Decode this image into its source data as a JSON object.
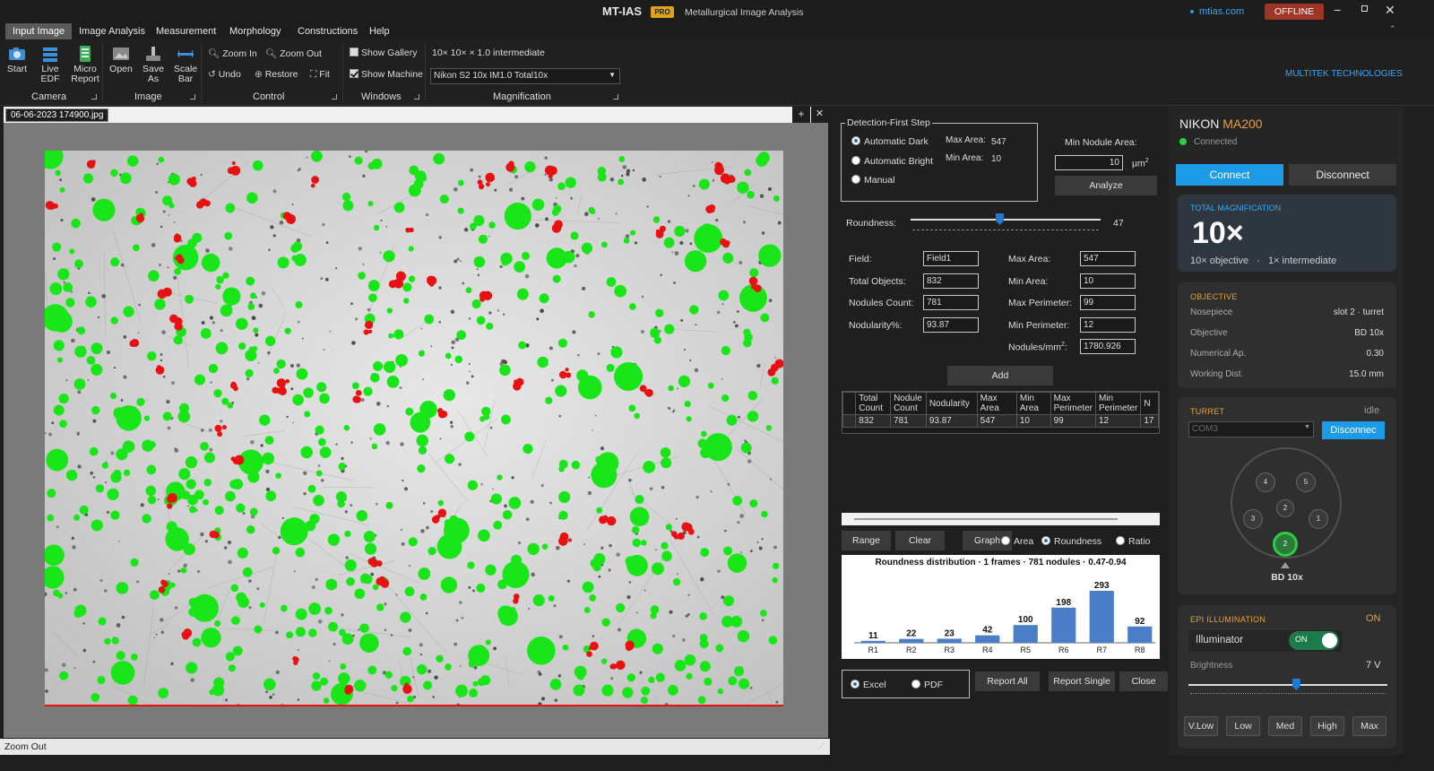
{
  "titlebar": {
    "app": "MT-IAS",
    "badge": "PRO",
    "subtitle": "Metallurgical Image Analysis",
    "site": "mtias.com",
    "offline": "OFFLINE"
  },
  "menu": [
    "Input Image",
    "Image Analysis",
    "Measurement",
    "Morphology",
    "Constructions",
    "Help"
  ],
  "ribbon": {
    "camera": {
      "start": "Start",
      "live_edf": "Live EDF",
      "micro_report_1": "Micro",
      "micro_report_2": "Report",
      "group": "Camera"
    },
    "image": {
      "open": "Open",
      "save_as": "Save As",
      "scale_bar_1": "Scale",
      "scale_bar_2": "Bar",
      "group": "Image"
    },
    "control": {
      "zoom_in": "Zoom In",
      "zoom_out": "Zoom Out",
      "undo": "Undo",
      "restore": "Restore",
      "fit": "Fit",
      "group": "Control"
    },
    "windows": {
      "show_gallery": "Show Gallery",
      "show_machine": "Show Machine",
      "group": "Windows"
    },
    "magnification": {
      "readout": "10×  10×  ×  1.0 intermediate",
      "select": "Nikon S2 10x IM1.0 Total10x",
      "group": "Magnification"
    },
    "brand": "MULTITEK TECHNOLOGIES"
  },
  "image_tab": {
    "name": "06-06-2023 174900.jpg"
  },
  "status": {
    "text": "Zoom Out"
  },
  "analysis": {
    "detection": {
      "title": "Detection-First Step",
      "auto_dark": "Automatic Dark",
      "auto_bright": "Automatic Bright",
      "manual": "Manual",
      "max_area_label": "Max Area:",
      "max_area_value": "547",
      "min_area_label": "Min Area:",
      "min_area_value": "10"
    },
    "min_nodule": {
      "label": "Min Nodule Area:",
      "value": "10",
      "unit": "µm",
      "analyze": "Analyze"
    },
    "roundness": {
      "label": "Roundness:",
      "value": "47"
    },
    "fields": {
      "field_label": "Field:",
      "field_value": "Field1",
      "total_label": "Total Objects:",
      "total_value": "832",
      "nodules_label": "Nodules Count:",
      "nodules_value": "781",
      "nodularity_label": "Nodularity%:",
      "nodularity_value": "93.87",
      "max_area_label": "Max Area:",
      "max_area_value": "547",
      "min_area_label": "Min Area:",
      "min_area_value": "10",
      "max_perim_label": "Max Perimeter:",
      "max_perim_value": "99",
      "min_perim_label": "Min Perimeter:",
      "min_perim_value": "12",
      "per_mm_label": "Nodules/mm",
      "per_mm_value": "1780.926"
    },
    "add": "Add",
    "table": {
      "headers": [
        [
          "Total",
          "Count"
        ],
        [
          "Nodule",
          "Count"
        ],
        [
          "Nodularity",
          ""
        ],
        [
          "Max",
          "Area"
        ],
        [
          "Min",
          "Area"
        ],
        [
          "Max",
          "Perimeter"
        ],
        [
          "Min",
          "Perimeter"
        ],
        [
          "N",
          ""
        ]
      ],
      "row": [
        "832",
        "781",
        "93.87",
        "547",
        "10",
        "99",
        "12",
        "17"
      ]
    },
    "buttons": {
      "range": "Range",
      "clear": "Clear",
      "graph": "Graph"
    },
    "graph_opts": {
      "area": "Area",
      "roundness": "Roundness",
      "ratio": "Ratio"
    },
    "chart_title": "Roundness distribution  ·  1 frames  ·  781 nodules  ·  0.47-0.94",
    "export": {
      "excel": "Excel",
      "pdf": "PDF",
      "report_all": "Report All",
      "report_single": "Report Single",
      "close": "Close"
    }
  },
  "chart_data": {
    "type": "bar",
    "title": "Roundness distribution  ·  1 frames  ·  781 nodules  ·  0.47-0.94",
    "categories": [
      "R1",
      "R2",
      "R3",
      "R4",
      "R5",
      "R6",
      "R7",
      "R8"
    ],
    "values": [
      11,
      22,
      23,
      42,
      100,
      198,
      293,
      92
    ],
    "color": "#4a7fc8"
  },
  "machine": {
    "title_a": "NIKON",
    "title_b": "MA200",
    "status": "Connected",
    "connect": "Connect",
    "disconnect": "Disconnect",
    "total_mag": {
      "label": "TOTAL MAGNIFICATION",
      "value": "10×",
      "objective": "10× objective",
      "dot": "·",
      "intermediate": "1× intermediate"
    },
    "objective": {
      "label": "OBJECTIVE",
      "rows": [
        {
          "k": "Nosepiece",
          "v": "slot 2  ·  turret"
        },
        {
          "k": "Objective",
          "v": "BD 10x"
        },
        {
          "k": "Numerical Ap.",
          "v": "0.30"
        },
        {
          "k": "Working Dist.",
          "v": "15.0 mm"
        }
      ]
    },
    "turret": {
      "label": "TURRET",
      "state": "idle",
      "port": "COM3",
      "disconnect": "Disconnec",
      "slots": [
        "4",
        "5",
        "3",
        "2",
        "1",
        "2"
      ],
      "current": "BD 10x"
    },
    "epi": {
      "label": "EPI ILLUMINATION",
      "state": "ON",
      "illuminator": "Illuminator",
      "toggle": "ON",
      "brightness": "Brightness",
      "volts": "7 V",
      "level": 0.54,
      "presets": [
        "V.Low",
        "Low",
        "Med",
        "High",
        "Max"
      ]
    }
  },
  "colors": {
    "accent": "#1e9be6",
    "orange": "#e6a23c",
    "green": "#2ecc40",
    "red": "#e81010",
    "offline": "#b53a2a"
  }
}
